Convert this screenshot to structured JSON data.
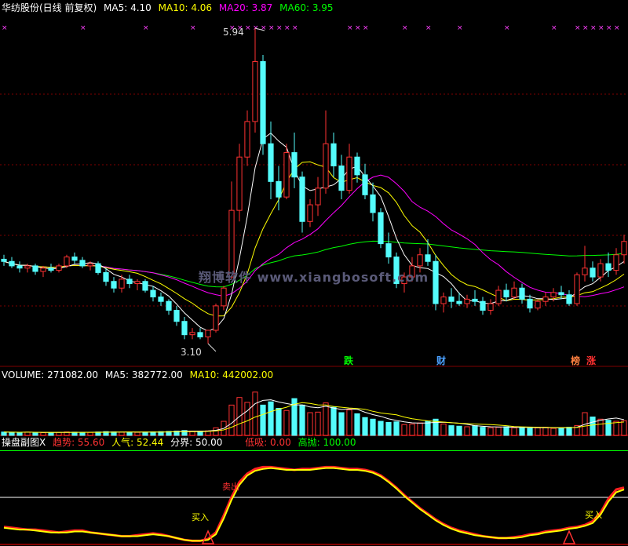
{
  "main_header": {
    "stock": "华纺股份(日线 前复权)",
    "ma5": "MA5: 4.10",
    "ma10": "MA10: 4.06",
    "ma20": "MA20: 3.87",
    "ma60": "MA60: 3.95"
  },
  "high_label": "5.94",
  "low_label": "3.10",
  "watermark": "翔博软件 www.xiangbosoft.com",
  "badges": [
    {
      "text": "跌",
      "color": "#00ff00"
    },
    {
      "text": "财",
      "color": "#4aa0ff"
    },
    {
      "text": "榜",
      "color": "#ff8040"
    },
    {
      "text": "涨",
      "color": "#ff3030"
    }
  ],
  "volume_header": {
    "volume": "VOLUME: 271082.00",
    "ma5": "MA5: 382772.00",
    "ma10": "MA10: 442002.00"
  },
  "indicator_header": {
    "name": "操盘副图X",
    "trend": "趋势: 55.60",
    "popularity": "人气: 52.44",
    "divide": "分界: 50.00",
    "low_buy": "低吸: 0.00",
    "high_sell": "高抛: 100.00"
  },
  "annotations": {
    "sell": "卖出",
    "buy_left": "买入",
    "buy_right": "买入"
  },
  "colors": {
    "up": "#ff3232",
    "down": "#54fcfc",
    "ma5": "#ffffff",
    "ma10": "#ffff00",
    "ma20": "#ff00ff",
    "ma60": "#00ff00",
    "grid": "#800000"
  },
  "chart_data": {
    "type": "candlestick",
    "price_range": [
      3.1,
      5.94
    ],
    "candles_ohlc": [
      [
        3.86,
        3.9,
        3.8,
        3.84
      ],
      [
        3.84,
        3.88,
        3.78,
        3.8
      ],
      [
        3.8,
        3.84,
        3.74,
        3.78
      ],
      [
        3.78,
        3.82,
        3.74,
        3.8
      ],
      [
        3.8,
        3.82,
        3.72,
        3.75
      ],
      [
        3.75,
        3.8,
        3.7,
        3.78
      ],
      [
        3.78,
        3.82,
        3.74,
        3.76
      ],
      [
        3.76,
        3.82,
        3.74,
        3.8
      ],
      [
        3.8,
        3.9,
        3.78,
        3.88
      ],
      [
        3.88,
        3.92,
        3.82,
        3.85
      ],
      [
        3.85,
        3.88,
        3.78,
        3.8
      ],
      [
        3.8,
        3.84,
        3.76,
        3.82
      ],
      [
        3.82,
        3.84,
        3.72,
        3.74
      ],
      [
        3.74,
        3.78,
        3.62,
        3.66
      ],
      [
        3.66,
        3.7,
        3.56,
        3.6
      ],
      [
        3.6,
        3.72,
        3.56,
        3.68
      ],
      [
        3.68,
        3.72,
        3.6,
        3.64
      ],
      [
        3.64,
        3.68,
        3.58,
        3.66
      ],
      [
        3.66,
        3.68,
        3.56,
        3.58
      ],
      [
        3.58,
        3.62,
        3.48,
        3.52
      ],
      [
        3.52,
        3.56,
        3.44,
        3.48
      ],
      [
        3.48,
        3.5,
        3.36,
        3.4
      ],
      [
        3.4,
        3.44,
        3.26,
        3.3
      ],
      [
        3.3,
        3.34,
        3.14,
        3.18
      ],
      [
        3.18,
        3.24,
        3.14,
        3.2
      ],
      [
        3.2,
        3.24,
        3.14,
        3.16
      ],
      [
        3.16,
        3.22,
        3.1,
        3.22
      ],
      [
        3.22,
        3.46,
        3.2,
        3.44
      ],
      [
        3.44,
        3.62,
        3.4,
        3.6
      ],
      [
        3.7,
        4.56,
        3.68,
        4.3
      ],
      [
        4.3,
        4.9,
        4.2,
        4.78
      ],
      [
        4.78,
        5.2,
        4.7,
        5.1
      ],
      [
        5.1,
        5.94,
        5.0,
        5.64
      ],
      [
        5.64,
        5.7,
        4.8,
        4.9
      ],
      [
        4.9,
        5.1,
        4.4,
        4.56
      ],
      [
        4.56,
        4.7,
        4.3,
        4.42
      ],
      [
        4.42,
        4.9,
        4.4,
        4.82
      ],
      [
        4.82,
        5.0,
        4.5,
        4.6
      ],
      [
        4.6,
        4.65,
        4.1,
        4.2
      ],
      [
        4.2,
        4.4,
        4.15,
        4.35
      ],
      [
        4.35,
        4.6,
        4.25,
        4.5
      ],
      [
        4.5,
        5.2,
        4.45,
        4.9
      ],
      [
        4.9,
        5.0,
        4.6,
        4.7
      ],
      [
        4.7,
        4.8,
        4.4,
        4.48
      ],
      [
        4.48,
        4.9,
        4.45,
        4.78
      ],
      [
        4.78,
        4.82,
        4.55,
        4.62
      ],
      [
        4.62,
        4.72,
        4.4,
        4.44
      ],
      [
        4.44,
        4.55,
        4.2,
        4.28
      ],
      [
        4.28,
        4.32,
        3.96,
        4.0
      ],
      [
        4.0,
        4.1,
        3.82,
        3.88
      ],
      [
        3.88,
        3.92,
        3.6,
        3.64
      ],
      [
        3.64,
        3.74,
        3.56,
        3.7
      ],
      [
        3.7,
        3.88,
        3.66,
        3.8
      ],
      [
        3.8,
        3.96,
        3.74,
        3.9
      ],
      [
        3.9,
        4.04,
        3.8,
        3.84
      ],
      [
        3.84,
        3.9,
        3.4,
        3.46
      ],
      [
        3.46,
        3.56,
        3.38,
        3.52
      ],
      [
        3.52,
        3.6,
        3.42,
        3.48
      ],
      [
        3.48,
        3.56,
        3.44,
        3.46
      ],
      [
        3.46,
        3.54,
        3.42,
        3.5
      ],
      [
        3.5,
        3.58,
        3.44,
        3.48
      ],
      [
        3.48,
        3.52,
        3.36,
        3.4
      ],
      [
        3.4,
        3.5,
        3.36,
        3.46
      ],
      [
        3.46,
        3.62,
        3.44,
        3.58
      ],
      [
        3.58,
        3.64,
        3.48,
        3.52
      ],
      [
        3.52,
        3.66,
        3.5,
        3.6
      ],
      [
        3.6,
        3.64,
        3.46,
        3.5
      ],
      [
        3.5,
        3.54,
        3.38,
        3.42
      ],
      [
        3.42,
        3.5,
        3.4,
        3.48
      ],
      [
        3.48,
        3.56,
        3.44,
        3.52
      ],
      [
        3.52,
        3.6,
        3.48,
        3.56
      ],
      [
        3.56,
        3.62,
        3.5,
        3.54
      ],
      [
        3.54,
        3.58,
        3.44,
        3.46
      ],
      [
        3.46,
        3.74,
        3.44,
        3.72
      ],
      [
        3.72,
        3.98,
        3.66,
        3.78
      ],
      [
        3.78,
        3.84,
        3.66,
        3.7
      ],
      [
        3.7,
        3.86,
        3.66,
        3.82
      ],
      [
        3.82,
        3.92,
        3.7,
        3.76
      ],
      [
        3.76,
        3.96,
        3.72,
        3.9
      ],
      [
        3.9,
        4.08,
        3.82,
        4.02
      ]
    ],
    "volume_range": [
      0,
      1000000
    ],
    "volume": [
      62000,
      58000,
      55000,
      60000,
      54000,
      50000,
      52000,
      56000,
      64000,
      60000,
      58000,
      55000,
      62000,
      70000,
      66000,
      60000,
      58000,
      56000,
      62000,
      66000,
      70000,
      74000,
      80000,
      90000,
      78000,
      76000,
      84000,
      140000,
      260000,
      560000,
      700000,
      610000,
      800000,
      560000,
      620000,
      500000,
      460000,
      680000,
      560000,
      420000,
      430000,
      600000,
      520000,
      420000,
      470000,
      400000,
      330000,
      300000,
      260000,
      240000,
      250000,
      200000,
      210000,
      230000,
      260000,
      300000,
      210000,
      180000,
      170000,
      160000,
      180000,
      150000,
      140000,
      150000,
      160000,
      140000,
      150000,
      130000,
      140000,
      150000,
      130000,
      140000,
      150000,
      180000,
      420000,
      340000,
      300000,
      280000,
      260000,
      271082
    ],
    "indicator_range": [
      0,
      100
    ],
    "indicator_values": {
      "trend": [
        18,
        17,
        16,
        15,
        15,
        14,
        13,
        12,
        13,
        14,
        14,
        12,
        11,
        10,
        9,
        8,
        8,
        9,
        10,
        11,
        10,
        8,
        6,
        4,
        3,
        3,
        5,
        12,
        30,
        50,
        66,
        75,
        80,
        82,
        82,
        81,
        80,
        79,
        80,
        80,
        81,
        82,
        82,
        81,
        80,
        80,
        79,
        77,
        73,
        67,
        60,
        52,
        45,
        38,
        32,
        26,
        21,
        17,
        14,
        12,
        10,
        8,
        7,
        6,
        6,
        7,
        8,
        10,
        11,
        13,
        14,
        15,
        17,
        18,
        20,
        24,
        33,
        48,
        58,
        60
      ],
      "popularity": [
        17,
        16,
        15,
        15,
        14,
        13,
        12,
        12,
        12,
        13,
        13,
        12,
        11,
        10,
        9,
        8,
        8,
        8,
        9,
        10,
        9,
        8,
        6,
        4,
        3,
        3,
        4,
        10,
        27,
        47,
        63,
        73,
        78,
        80,
        81,
        80,
        79,
        79,
        79,
        79,
        80,
        81,
        81,
        80,
        79,
        79,
        78,
        76,
        72,
        66,
        59,
        51,
        44,
        37,
        31,
        25,
        20,
        16,
        13,
        11,
        9,
        8,
        7,
        6,
        6,
        6,
        7,
        9,
        10,
        12,
        13,
        14,
        16,
        17,
        19,
        22,
        31,
        45,
        55,
        58
      ],
      "divide": 50,
      "low_buy": 0,
      "high_sell": 100
    }
  }
}
